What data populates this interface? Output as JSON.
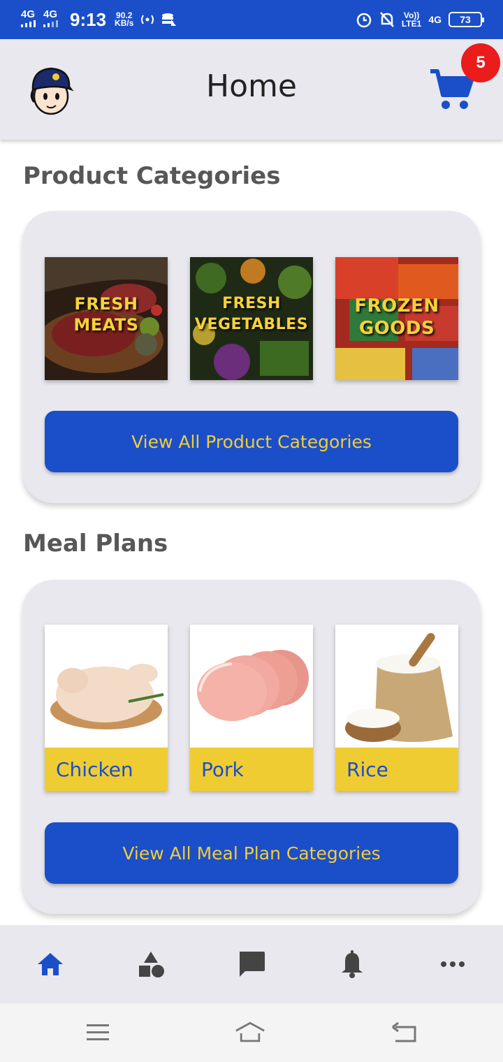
{
  "status_bar": {
    "network_1": "4G",
    "network_2": "4G",
    "time": "9:13",
    "speed_value": "90.2",
    "speed_unit": "KB/s",
    "volte": "Vo))",
    "lte": "LTE1",
    "network_3": "4G",
    "battery": "73"
  },
  "app_bar": {
    "title": "Home",
    "cart_count": "5"
  },
  "product_categories": {
    "title": "Product Categories",
    "items": [
      {
        "line1": "FRESH",
        "line2": "MEATS"
      },
      {
        "line1": "FRESH",
        "line2": "VEGETABLES"
      },
      {
        "line1": "FROZEN",
        "line2": "GOODS"
      }
    ],
    "button_label": "View All Product Categories"
  },
  "meal_plans": {
    "title": "Meal Plans",
    "items": [
      {
        "label": "Chicken"
      },
      {
        "label": "Pork"
      },
      {
        "label": "Rice"
      }
    ],
    "button_label": "View All Meal Plan Categories"
  },
  "bottom_nav": {
    "items": [
      "home-icon",
      "shapes-icon",
      "chat-icon",
      "bell-icon",
      "more-icon"
    ],
    "active_color": "#1a4fc9",
    "inactive_color": "#444444"
  },
  "colors": {
    "primary": "#1a4fc9",
    "accent_yellow": "#f0cc33",
    "badge_red": "#ea1c1c"
  }
}
